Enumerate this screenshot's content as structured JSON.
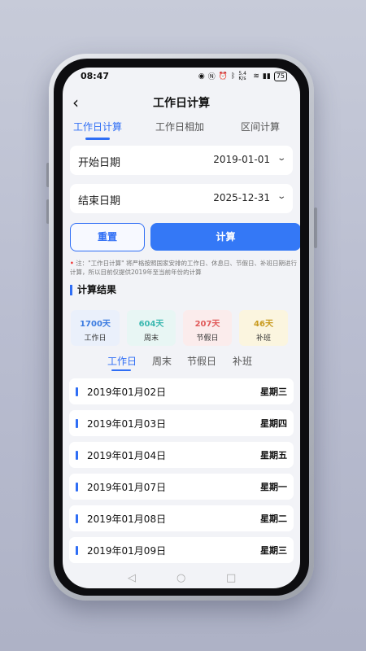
{
  "status": {
    "time": "08:47",
    "net": "5.4 K/s",
    "battery": "75"
  },
  "header": {
    "back_icon": "back-arrow-icon",
    "title": "工作日计算"
  },
  "tabs": [
    {
      "label": "工作日计算",
      "active": true
    },
    {
      "label": "工作日相加"
    },
    {
      "label": "区间计算"
    }
  ],
  "start": {
    "label": "开始日期",
    "value": "2019-01-01"
  },
  "end": {
    "label": "结束日期",
    "value": "2025-12-31"
  },
  "buttons": {
    "reset": "重置",
    "calc": "计算"
  },
  "note": "注：\"工作日计算\" 将严格按照国家安排的工作日、休息日、节假日、补班日期进行计算，所以目前仅提供2019年至当前年份的计算",
  "result_title": "计算结果",
  "stats": [
    {
      "value": "1700天",
      "label": "工作日",
      "color": "#3b7be0",
      "bg": "#eaf0fb"
    },
    {
      "value": "604天",
      "label": "周末",
      "color": "#3bb8b0",
      "bg": "#e8f6f4"
    },
    {
      "value": "207天",
      "label": "节假日",
      "color": "#e05a5a",
      "bg": "#fbecec"
    },
    {
      "value": "46天",
      "label": "补班",
      "color": "#c89a1e",
      "bg": "#fbf5df"
    }
  ],
  "subtabs": [
    {
      "label": "工作日",
      "active": true
    },
    {
      "label": "周末"
    },
    {
      "label": "节假日"
    },
    {
      "label": "补班"
    }
  ],
  "list": [
    {
      "date": "2019年01月02日",
      "weekday": "星期三"
    },
    {
      "date": "2019年01月03日",
      "weekday": "星期四"
    },
    {
      "date": "2019年01月04日",
      "weekday": "星期五"
    },
    {
      "date": "2019年01月07日",
      "weekday": "星期一"
    },
    {
      "date": "2019年01月08日",
      "weekday": "星期二"
    },
    {
      "date": "2019年01月09日",
      "weekday": "星期三"
    }
  ],
  "colors": {
    "accent": "#2f6ef5"
  }
}
